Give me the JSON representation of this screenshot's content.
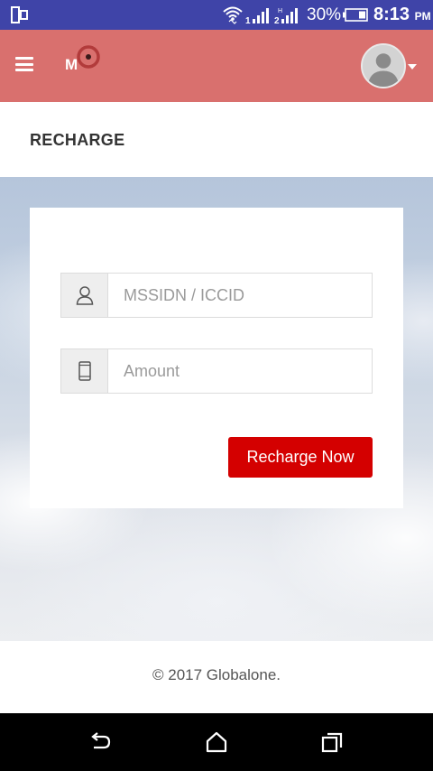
{
  "status_bar": {
    "battery_percent": "30%",
    "time": "8:13",
    "time_suffix": "PM"
  },
  "header": {
    "menu_icon": "hamburger-icon",
    "logo_icon": "brand-logo",
    "avatar_icon": "user-avatar"
  },
  "page": {
    "title": "RECHARGE"
  },
  "form": {
    "msisdn": {
      "placeholder": "MSSIDN / ICCID",
      "value": "",
      "icon": "user-icon"
    },
    "amount": {
      "placeholder": "Amount",
      "value": "",
      "icon": "mobile-phone-icon"
    },
    "submit_label": "Recharge Now"
  },
  "footer": {
    "copyright": "© 2017 Globalone."
  },
  "colors": {
    "status_bar": "#3f44a8",
    "header": "#d9706e",
    "button": "#d40000"
  }
}
